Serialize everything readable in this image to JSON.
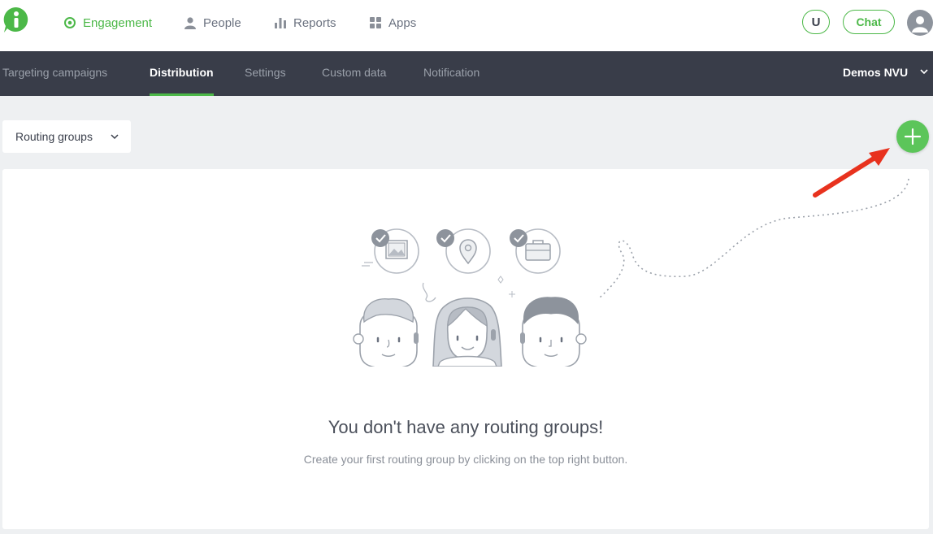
{
  "topnav": {
    "items": [
      {
        "label": "Engagement",
        "icon": "target-icon",
        "active": true
      },
      {
        "label": "People",
        "icon": "person-icon",
        "active": false
      },
      {
        "label": "Reports",
        "icon": "bar-chart-icon",
        "active": false
      },
      {
        "label": "Apps",
        "icon": "grid-icon",
        "active": false
      }
    ],
    "magnet_label": "U",
    "chat_label": "Chat"
  },
  "subnav": {
    "tabs": [
      {
        "label": "Targeting campaigns",
        "active": false
      },
      {
        "label": "Distribution",
        "active": true
      },
      {
        "label": "Settings",
        "active": false
      },
      {
        "label": "Custom data",
        "active": false
      },
      {
        "label": "Notification",
        "active": false
      }
    ],
    "account": "Demos NVU"
  },
  "toolbar": {
    "dropdown_value": "Routing groups"
  },
  "empty_state": {
    "title": "You don't have any routing groups!",
    "subtitle": "Create your first routing group by clicking on the top right button."
  },
  "colors": {
    "brand_green": "#4cb848",
    "subnav_bg": "#393d49",
    "page_bg": "#eef0f2",
    "annotation_arrow": "#e8321e"
  }
}
